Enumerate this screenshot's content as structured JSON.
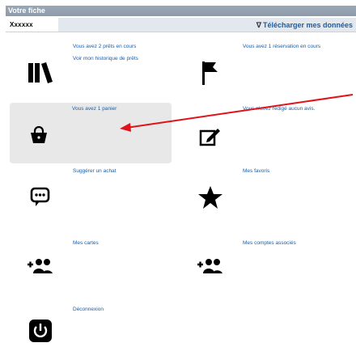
{
  "header": {
    "title": "Votre fiche",
    "username": "Xxxxxx",
    "download_label": "Télécharger mes données",
    "download_icon": "chevrons-down-icon"
  },
  "cards": [
    {
      "id": "loans",
      "icon": "books-icon",
      "lines": [
        "Vous avez 2 prêts en cours",
        "Voir mon historique de prêts"
      ]
    },
    {
      "id": "reservations",
      "icon": "flag-icon",
      "lines": [
        "Vous avez 1 réservation en cours"
      ]
    },
    {
      "id": "basket",
      "icon": "basket-icon",
      "lines": [
        "Vous avez 1 panier"
      ]
    },
    {
      "id": "reviews",
      "icon": "edit-icon",
      "lines": [
        "Vous n'avez rédigé aucun avis."
      ]
    },
    {
      "id": "suggest",
      "icon": "chat-icon",
      "lines": [
        "Suggérer un achat"
      ]
    },
    {
      "id": "favorites",
      "icon": "star-icon",
      "lines": [
        "Mes favoris"
      ]
    },
    {
      "id": "cards",
      "icon": "add-users-icon",
      "lines": [
        "Mes cartes"
      ]
    },
    {
      "id": "linked",
      "icon": "add-users-icon",
      "lines": [
        "Mes comptes associés"
      ]
    },
    {
      "id": "logout",
      "icon": "power-icon",
      "lines": [
        "Déconnexion"
      ]
    }
  ],
  "colors": {
    "link": "#1a5ea8",
    "header_bar": "#9aa7b5",
    "arrow": "#e0131a",
    "highlight": "#e8e8e8"
  }
}
